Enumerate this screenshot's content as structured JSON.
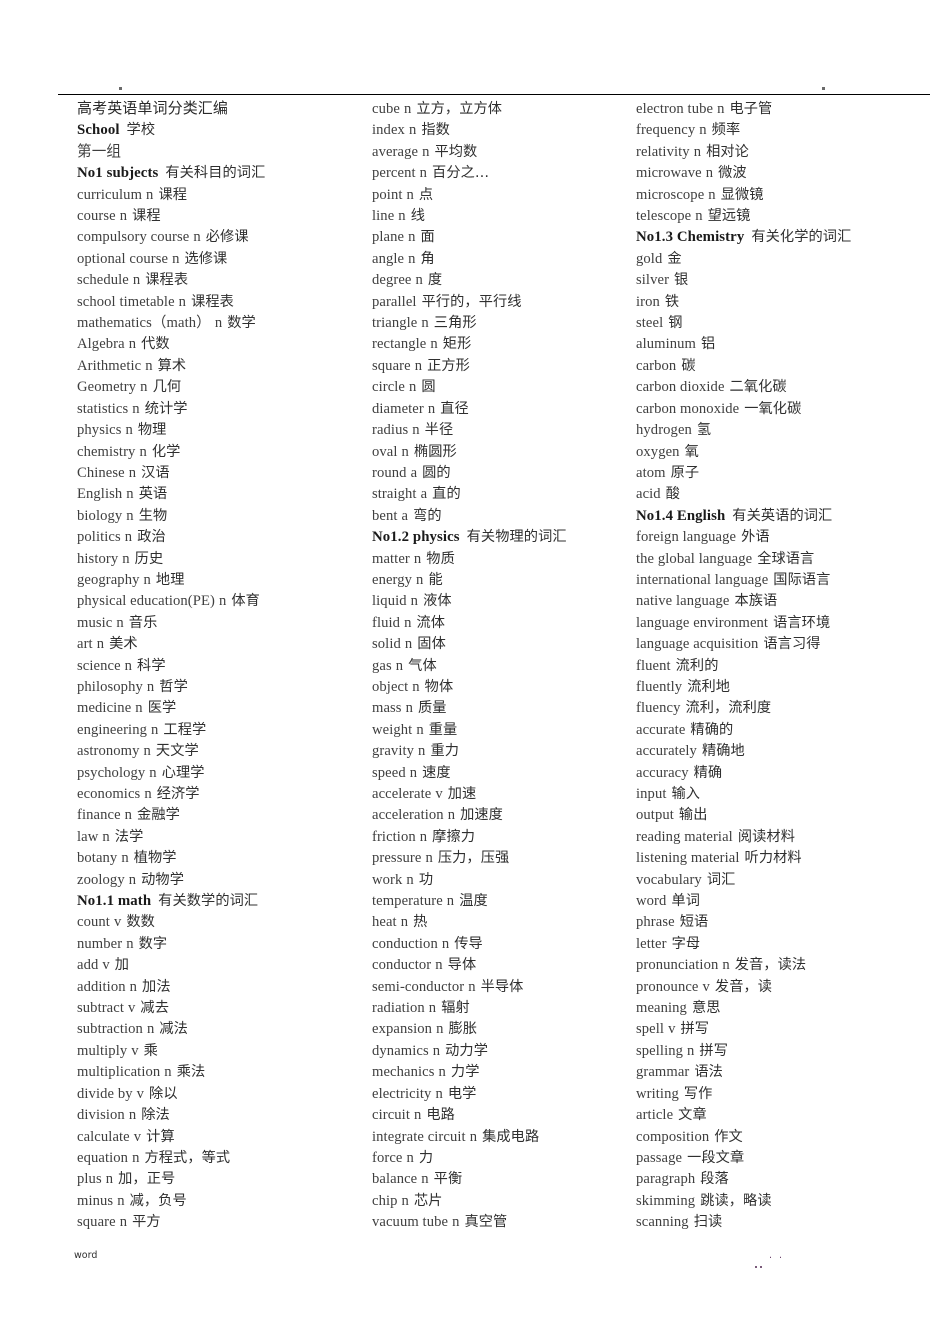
{
  "document": {
    "title": "高考英语单词分类汇编",
    "footer_left": "word",
    "footer_right": ". ."
  },
  "columns": [
    {
      "id": "column-1",
      "lines": [
        {
          "style": "title",
          "en": "高考英语单词分类汇编",
          "pos": "",
          "cn": ""
        },
        {
          "style": "bold",
          "en": "School",
          "pos": "",
          "cn": "学校"
        },
        {
          "style": "plain",
          "en": "第一组",
          "pos": "",
          "cn": ""
        },
        {
          "style": "bold",
          "en": "No1  subjects",
          "pos": "",
          "cn": "有关科目的词汇"
        },
        {
          "style": "plain",
          "en": "curriculum",
          "pos": "n",
          "cn": "课程"
        },
        {
          "style": "plain",
          "en": "course",
          "pos": "n",
          "cn": "课程"
        },
        {
          "style": "plain",
          "en": "compulsory course",
          "pos": "n",
          "cn": "必修课"
        },
        {
          "style": "plain",
          "en": "optional course",
          "pos": "n",
          "cn": "选修课"
        },
        {
          "style": "plain",
          "en": "schedule",
          "pos": "n",
          "cn": "课程表"
        },
        {
          "style": "plain",
          "en": "school timetable",
          "pos": "n",
          "cn": "课程表"
        },
        {
          "style": "plain",
          "en": "mathematics（math）",
          "pos": "n",
          "cn": "数学"
        },
        {
          "style": "plain",
          "en": "Algebra",
          "pos": "n",
          "cn": "代数"
        },
        {
          "style": "plain",
          "en": "Arithmetic",
          "pos": "n",
          "cn": "算术"
        },
        {
          "style": "plain",
          "en": "Geometry",
          "pos": "n",
          "cn": "几何"
        },
        {
          "style": "plain",
          "en": "statistics",
          "pos": "n",
          "cn": "统计学"
        },
        {
          "style": "plain",
          "en": "physics",
          "pos": "n",
          "cn": "物理"
        },
        {
          "style": "plain",
          "en": "chemistry",
          "pos": "n",
          "cn": "化学"
        },
        {
          "style": "plain",
          "en": "Chinese",
          "pos": "n",
          "cn": "汉语"
        },
        {
          "style": "plain",
          "en": "English",
          "pos": "n",
          "cn": "英语"
        },
        {
          "style": "plain",
          "en": "biology",
          "pos": "n",
          "cn": "生物"
        },
        {
          "style": "plain",
          "en": "politics",
          "pos": "n",
          "cn": "政治"
        },
        {
          "style": "plain",
          "en": "history",
          "pos": "n",
          "cn": "历史"
        },
        {
          "style": "plain",
          "en": "geography",
          "pos": "n",
          "cn": "地理"
        },
        {
          "style": "plain",
          "en": "physical education(PE)",
          "pos": "n",
          "cn": "体育"
        },
        {
          "style": "plain",
          "en": "music",
          "pos": "n",
          "cn": "音乐"
        },
        {
          "style": "plain",
          "en": "art",
          "pos": "n",
          "cn": "美术"
        },
        {
          "style": "plain",
          "en": "science",
          "pos": "n",
          "cn": "科学"
        },
        {
          "style": "plain",
          "en": "philosophy",
          "pos": "n",
          "cn": "哲学"
        },
        {
          "style": "plain",
          "en": "medicine",
          "pos": "n",
          "cn": "医学"
        },
        {
          "style": "plain",
          "en": "engineering",
          "pos": "n",
          "cn": "工程学"
        },
        {
          "style": "plain",
          "en": "astronomy",
          "pos": "n",
          "cn": "天文学"
        },
        {
          "style": "plain",
          "en": "psychology",
          "pos": "n",
          "cn": "心理学"
        },
        {
          "style": "plain",
          "en": "economics",
          "pos": "n",
          "cn": "经济学"
        },
        {
          "style": "plain",
          "en": "finance",
          "pos": "n",
          "cn": "金融学"
        },
        {
          "style": "plain",
          "en": "law",
          "pos": "n",
          "cn": "法学"
        },
        {
          "style": "plain",
          "en": "botany",
          "pos": "n",
          "cn": "植物学"
        },
        {
          "style": "plain",
          "en": "zoology",
          "pos": "n",
          "cn": "动物学"
        },
        {
          "style": "bold",
          "en": "No1.1  math",
          "pos": "",
          "cn": "有关数学的词汇"
        },
        {
          "style": "plain",
          "en": "count",
          "pos": "v",
          "cn": "数数"
        },
        {
          "style": "plain",
          "en": "number",
          "pos": "n",
          "cn": "数字"
        },
        {
          "style": "plain",
          "en": "add",
          "pos": "v",
          "cn": "加"
        },
        {
          "style": "plain",
          "en": "addition",
          "pos": "n",
          "cn": "加法"
        },
        {
          "style": "plain",
          "en": "subtract",
          "pos": "v",
          "cn": "减去"
        },
        {
          "style": "plain",
          "en": "subtraction",
          "pos": "n",
          "cn": "减法"
        },
        {
          "style": "plain",
          "en": "multiply",
          "pos": "v",
          "cn": "乘"
        },
        {
          "style": "plain",
          "en": "multiplication",
          "pos": "n",
          "cn": "乘法"
        },
        {
          "style": "plain",
          "en": "divide by",
          "pos": "v",
          "cn": "除以"
        },
        {
          "style": "plain",
          "en": "division",
          "pos": "n",
          "cn": "除法"
        },
        {
          "style": "plain",
          "en": "calculate",
          "pos": "v",
          "cn": "计算"
        },
        {
          "style": "plain",
          "en": "equation",
          "pos": "n",
          "cn": "方程式，等式"
        },
        {
          "style": "plain",
          "en": "plus",
          "pos": "n",
          "cn": "加，正号"
        },
        {
          "style": "plain",
          "en": "minus",
          "pos": "n",
          "cn": "减，负号"
        },
        {
          "style": "plain",
          "en": "square",
          "pos": "n",
          "cn": "平方"
        }
      ]
    },
    {
      "id": "column-2",
      "lines": [
        {
          "style": "plain",
          "en": "cube",
          "pos": "n",
          "cn": "立方，立方体"
        },
        {
          "style": "plain",
          "en": "index",
          "pos": "n",
          "cn": "指数"
        },
        {
          "style": "plain",
          "en": "average",
          "pos": "n",
          "cn": "平均数"
        },
        {
          "style": "plain",
          "en": "percent",
          "pos": "n",
          "cn": "百分之…"
        },
        {
          "style": "plain",
          "en": "point",
          "pos": "n",
          "cn": "点"
        },
        {
          "style": "plain",
          "en": "line",
          "pos": "n",
          "cn": "线"
        },
        {
          "style": "plain",
          "en": "plane",
          "pos": "n",
          "cn": "面"
        },
        {
          "style": "plain",
          "en": "angle",
          "pos": "n",
          "cn": "角"
        },
        {
          "style": "plain",
          "en": "degree",
          "pos": "n",
          "cn": "度"
        },
        {
          "style": "plain",
          "en": "parallel",
          "pos": "",
          "cn": "平行的，平行线"
        },
        {
          "style": "plain",
          "en": "triangle",
          "pos": "n",
          "cn": "三角形"
        },
        {
          "style": "plain",
          "en": "rectangle",
          "pos": "n",
          "cn": "矩形"
        },
        {
          "style": "plain",
          "en": "square",
          "pos": "n",
          "cn": "正方形"
        },
        {
          "style": "plain",
          "en": "circle",
          "pos": "n",
          "cn": "圆"
        },
        {
          "style": "plain",
          "en": "diameter",
          "pos": "n",
          "cn": "直径"
        },
        {
          "style": "plain",
          "en": "radius",
          "pos": "n",
          "cn": "半径"
        },
        {
          "style": "plain",
          "en": "oval",
          "pos": "n",
          "cn": "椭圆形"
        },
        {
          "style": "plain",
          "en": "round",
          "pos": "a",
          "cn": "圆的"
        },
        {
          "style": "plain",
          "en": "straight",
          "pos": "a",
          "cn": "直的"
        },
        {
          "style": "plain",
          "en": "bent",
          "pos": "a",
          "cn": "弯的"
        },
        {
          "style": "bold",
          "en": "No1.2  physics",
          "pos": "",
          "cn": "有关物理的词汇"
        },
        {
          "style": "plain",
          "en": "matter",
          "pos": "n",
          "cn": "物质"
        },
        {
          "style": "plain",
          "en": "energy",
          "pos": "n",
          "cn": "能"
        },
        {
          "style": "plain",
          "en": "liquid",
          "pos": "n",
          "cn": "液体"
        },
        {
          "style": "plain",
          "en": "fluid",
          "pos": "n",
          "cn": "流体"
        },
        {
          "style": "plain",
          "en": "solid",
          "pos": "n",
          "cn": "固体"
        },
        {
          "style": "plain",
          "en": "gas",
          "pos": "n",
          "cn": "气体"
        },
        {
          "style": "plain",
          "en": "object",
          "pos": "n",
          "cn": "物体"
        },
        {
          "style": "plain",
          "en": "mass",
          "pos": "n",
          "cn": "质量"
        },
        {
          "style": "plain",
          "en": "weight",
          "pos": "n",
          "cn": "重量"
        },
        {
          "style": "plain",
          "en": "gravity",
          "pos": "n",
          "cn": "重力"
        },
        {
          "style": "plain",
          "en": "speed",
          "pos": "n",
          "cn": "速度"
        },
        {
          "style": "plain",
          "en": "accelerate",
          "pos": "v",
          "cn": "加速"
        },
        {
          "style": "plain",
          "en": "acceleration",
          "pos": "n",
          "cn": "加速度"
        },
        {
          "style": "plain",
          "en": "friction",
          "pos": "n",
          "cn": "摩擦力"
        },
        {
          "style": "plain",
          "en": "pressure",
          "pos": "n",
          "cn": "压力，压强"
        },
        {
          "style": "plain",
          "en": "work",
          "pos": "n",
          "cn": "功"
        },
        {
          "style": "plain",
          "en": "temperature",
          "pos": "n",
          "cn": "温度"
        },
        {
          "style": "plain",
          "en": "heat",
          "pos": "n",
          "cn": "热"
        },
        {
          "style": "plain",
          "en": "conduction",
          "pos": "n",
          "cn": "传导"
        },
        {
          "style": "plain",
          "en": "conductor",
          "pos": "n",
          "cn": "导体"
        },
        {
          "style": "plain",
          "en": "semi-conductor",
          "pos": "n",
          "cn": "半导体"
        },
        {
          "style": "plain",
          "en": "radiation",
          "pos": "n",
          "cn": "辐射"
        },
        {
          "style": "plain",
          "en": "expansion",
          "pos": "n",
          "cn": "膨胀"
        },
        {
          "style": "plain",
          "en": "dynamics",
          "pos": "n",
          "cn": "动力学"
        },
        {
          "style": "plain",
          "en": "mechanics",
          "pos": "n",
          "cn": "力学"
        },
        {
          "style": "plain",
          "en": "electricity",
          "pos": "n",
          "cn": "电学"
        },
        {
          "style": "plain",
          "en": "circuit",
          "pos": "n",
          "cn": "电路"
        },
        {
          "style": "plain",
          "en": "integrate circuit",
          "pos": "n",
          "cn": "集成电路"
        },
        {
          "style": "plain",
          "en": "force",
          "pos": "n",
          "cn": "力"
        },
        {
          "style": "plain",
          "en": "balance",
          "pos": "n",
          "cn": "平衡"
        },
        {
          "style": "plain",
          "en": "chip",
          "pos": "n",
          "cn": "芯片"
        },
        {
          "style": "plain",
          "en": "vacuum tube",
          "pos": "n",
          "cn": "真空管"
        }
      ]
    },
    {
      "id": "column-3",
      "lines": [
        {
          "style": "plain",
          "en": "electron tube",
          "pos": "n",
          "cn": "电子管"
        },
        {
          "style": "plain",
          "en": "frequency",
          "pos": "n",
          "cn": "频率"
        },
        {
          "style": "plain",
          "en": "relativity",
          "pos": "n",
          "cn": "相对论"
        },
        {
          "style": "plain",
          "en": "microwave",
          "pos": "n",
          "cn": "微波"
        },
        {
          "style": "plain",
          "en": "microscope",
          "pos": "n",
          "cn": "显微镜"
        },
        {
          "style": "plain",
          "en": "telescope",
          "pos": "n",
          "cn": "望远镜"
        },
        {
          "style": "bold",
          "en": "No1.3  Chemistry",
          "pos": "",
          "cn": "有关化学的词汇"
        },
        {
          "style": "plain",
          "en": "gold",
          "pos": "",
          "cn": "金"
        },
        {
          "style": "plain",
          "en": "silver",
          "pos": "",
          "cn": "银"
        },
        {
          "style": "plain",
          "en": "iron",
          "pos": "",
          "cn": "铁"
        },
        {
          "style": "plain",
          "en": "steel",
          "pos": "",
          "cn": "钢"
        },
        {
          "style": "plain",
          "en": "aluminum",
          "pos": "",
          "cn": "铝"
        },
        {
          "style": "plain",
          "en": "carbon",
          "pos": "",
          "cn": "碳"
        },
        {
          "style": "plain",
          "en": "carbon dioxide",
          "pos": "",
          "cn": "二氧化碳"
        },
        {
          "style": "plain",
          "en": "carbon monoxide",
          "pos": "",
          "cn": "一氧化碳"
        },
        {
          "style": "plain",
          "en": "hydrogen",
          "pos": "",
          "cn": "氢"
        },
        {
          "style": "plain",
          "en": "oxygen",
          "pos": "",
          "cn": "氧"
        },
        {
          "style": "plain",
          "en": "atom",
          "pos": "",
          "cn": "原子"
        },
        {
          "style": "plain",
          "en": "acid",
          "pos": "",
          "cn": "酸"
        },
        {
          "style": "bold",
          "en": "No1.4  English",
          "pos": "",
          "cn": "有关英语的词汇"
        },
        {
          "style": "plain",
          "en": "foreign language",
          "pos": "",
          "cn": "外语"
        },
        {
          "style": "plain",
          "en": "the global language",
          "pos": "",
          "cn": "全球语言"
        },
        {
          "style": "plain",
          "en": "international language",
          "pos": "",
          "cn": "国际语言"
        },
        {
          "style": "plain",
          "en": "native language",
          "pos": "",
          "cn": "本族语"
        },
        {
          "style": "plain",
          "en": "language environment",
          "pos": "",
          "cn": "语言环境"
        },
        {
          "style": "plain",
          "en": "language acquisition",
          "pos": "",
          "cn": "语言习得"
        },
        {
          "style": "plain",
          "en": "fluent",
          "pos": "",
          "cn": "流利的"
        },
        {
          "style": "plain",
          "en": "fluently",
          "pos": "",
          "cn": "流利地"
        },
        {
          "style": "plain",
          "en": "fluency",
          "pos": "",
          "cn": "流利，流利度"
        },
        {
          "style": "plain",
          "en": "accurate",
          "pos": "",
          "cn": "精确的"
        },
        {
          "style": "plain",
          "en": "accurately",
          "pos": "",
          "cn": "精确地"
        },
        {
          "style": "plain",
          "en": "accuracy",
          "pos": "",
          "cn": "精确"
        },
        {
          "style": "plain",
          "en": "input",
          "pos": "",
          "cn": "输入"
        },
        {
          "style": "plain",
          "en": "output",
          "pos": "",
          "cn": "输出"
        },
        {
          "style": "plain",
          "en": "reading material",
          "pos": "",
          "cn": "阅读材料"
        },
        {
          "style": "plain",
          "en": "listening material",
          "pos": "",
          "cn": "听力材料"
        },
        {
          "style": "plain",
          "en": "vocabulary",
          "pos": "",
          "cn": "词汇"
        },
        {
          "style": "plain",
          "en": "word",
          "pos": "",
          "cn": "单词"
        },
        {
          "style": "plain",
          "en": "phrase",
          "pos": "",
          "cn": "短语"
        },
        {
          "style": "plain",
          "en": "letter",
          "pos": "",
          "cn": "字母"
        },
        {
          "style": "plain",
          "en": "pronunciation",
          "pos": "n",
          "cn": "发音，读法"
        },
        {
          "style": "plain",
          "en": "pronounce",
          "pos": "v",
          "cn": "发音，读"
        },
        {
          "style": "plain",
          "en": "meaning",
          "pos": "",
          "cn": "意思"
        },
        {
          "style": "plain",
          "en": "spell",
          "pos": "v",
          "cn": "拼写"
        },
        {
          "style": "plain",
          "en": "spelling",
          "pos": "n",
          "cn": "拼写"
        },
        {
          "style": "plain",
          "en": "grammar",
          "pos": "",
          "cn": "语法"
        },
        {
          "style": "plain",
          "en": "writing",
          "pos": "",
          "cn": "写作"
        },
        {
          "style": "plain",
          "en": "article",
          "pos": "",
          "cn": "文章"
        },
        {
          "style": "plain",
          "en": "composition",
          "pos": "",
          "cn": "作文"
        },
        {
          "style": "plain",
          "en": "passage",
          "pos": "",
          "cn": "一段文章"
        },
        {
          "style": "plain",
          "en": "paragraph",
          "pos": "",
          "cn": "段落"
        },
        {
          "style": "plain",
          "en": "skimming",
          "pos": "",
          "cn": "跳读，略读"
        },
        {
          "style": "plain",
          "en": "scanning",
          "pos": "",
          "cn": "扫读"
        }
      ]
    }
  ]
}
